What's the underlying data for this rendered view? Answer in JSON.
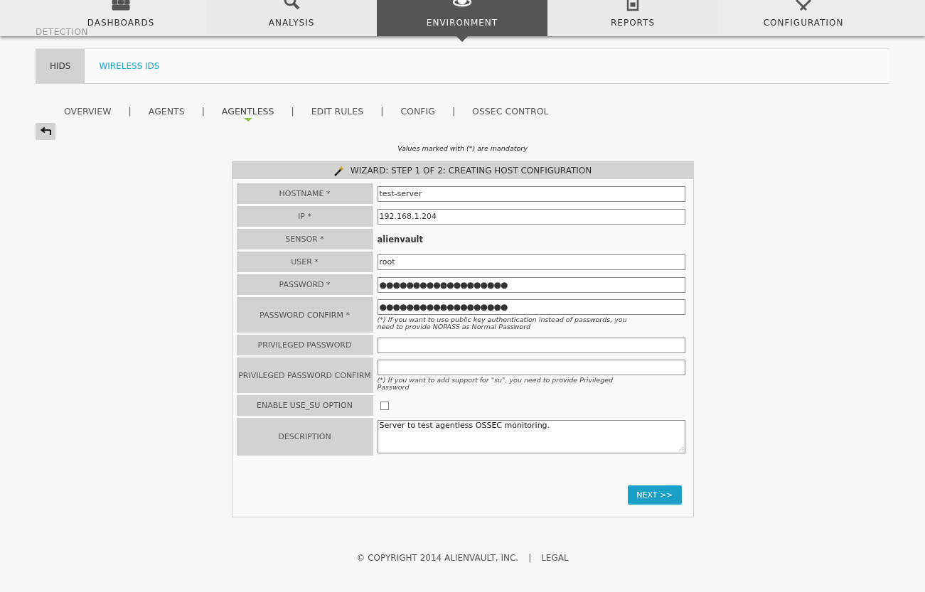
{
  "main_nav": [
    {
      "label": "DASHBOARDS",
      "selected": false
    },
    {
      "label": "ANALYSIS",
      "selected": false
    },
    {
      "label": "ENVIRONMENT",
      "selected": true
    },
    {
      "label": "REPORTS",
      "selected": false
    },
    {
      "label": "CONFIGURATION",
      "selected": false
    }
  ],
  "breadcrumb": "DETECTION",
  "tabs": [
    {
      "label": "HIDS",
      "selected": true
    },
    {
      "label": "WIRELESS IDS",
      "selected": false
    }
  ],
  "sub_nav_separator": "|",
  "sub_nav": [
    {
      "label": "OVERVIEW",
      "selected": false
    },
    {
      "label": "AGENTS",
      "selected": false
    },
    {
      "label": "AGENTLESS",
      "selected": true
    },
    {
      "label": "EDIT RULES",
      "selected": false
    },
    {
      "label": "CONFIG",
      "selected": false
    },
    {
      "label": "OSSEC CONTROL",
      "selected": false
    }
  ],
  "mandatory_note": "Values marked with (*) are mandatory",
  "wizard": {
    "title": "WIZARD: STEP 1 OF 2: CREATING HOST CONFIGURATION",
    "fields": [
      {
        "kind": "input",
        "label": "HOSTNAME *",
        "value": "test-server"
      },
      {
        "kind": "input",
        "label": "IP *",
        "value": "192.168.1.204"
      },
      {
        "kind": "static",
        "label": "SENSOR *",
        "value": "alienvault"
      },
      {
        "kind": "input",
        "label": "USER *",
        "value": "root"
      },
      {
        "kind": "password",
        "label": "PASSWORD *",
        "value": "●●●●●●●●●●●●●●●●●●●"
      },
      {
        "kind": "password",
        "label": "PASSWORD CONFIRM *",
        "value": "●●●●●●●●●●●●●●●●●●●",
        "help": "(*) If you want to use public key authentication instead of passwords, you need to provide NOPASS as Normal Password"
      },
      {
        "kind": "password",
        "label": "PRIVILEGED PASSWORD"
      },
      {
        "kind": "password",
        "label": "PRIVILEGED PASSWORD CONFIRM",
        "help": "(*) If you want to add support for \"su\", you need to provide Privileged Password"
      },
      {
        "kind": "checkbox",
        "label": "ENABLE USE_SU OPTION",
        "checked": false
      },
      {
        "kind": "textarea",
        "label": "DESCRIPTION",
        "value": "Server to test agentless OSSEC monitoring."
      }
    ],
    "next_button": "NEXT >>"
  },
  "footer": {
    "copyright": "© COPYRIGHT 2014 ALIENVAULT, INC.",
    "separator": "|",
    "legal": "LEGAL"
  }
}
